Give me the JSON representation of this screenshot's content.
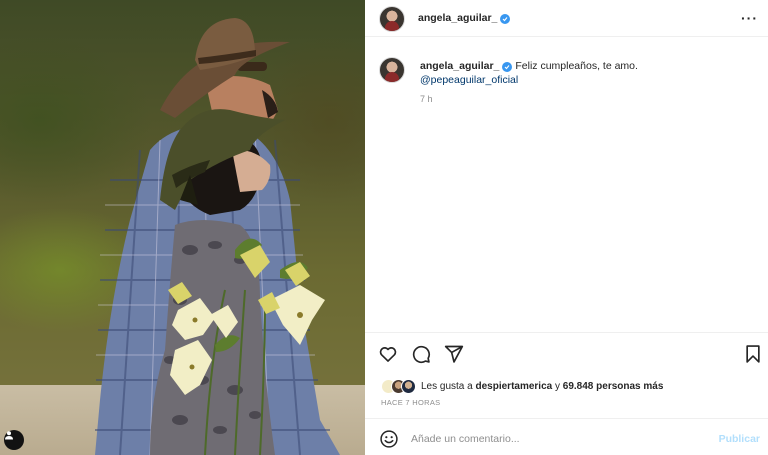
{
  "post": {
    "author": "angela_aguilar_",
    "verified": true
  },
  "caption": {
    "author": "angela_aguilar_",
    "text": "Feliz cumpleaños, te amo.",
    "mention": "@pepeaguilar_oficial",
    "time_ago": "7 h"
  },
  "likes": {
    "prefix": "Les gusta a",
    "first_user": "despiertamerica",
    "connector": "y",
    "count_text": "69.848 personas más"
  },
  "posted_ago": "HACE 7 HORAS",
  "comment": {
    "placeholder": "Añade un comentario...",
    "publish_label": "Publicar"
  },
  "icons": {
    "more": "more-options-icon",
    "like": "heart-icon",
    "comment": "comment-icon",
    "share": "share-icon",
    "save": "bookmark-icon",
    "emoji": "emoji-icon",
    "tag": "user-tag-icon",
    "verified": "verified-badge-icon"
  },
  "colors": {
    "verified": "#3897f0",
    "mention": "#00376b",
    "publish_disabled": "#b2dffc",
    "secondary_text": "#8e8e8e"
  }
}
